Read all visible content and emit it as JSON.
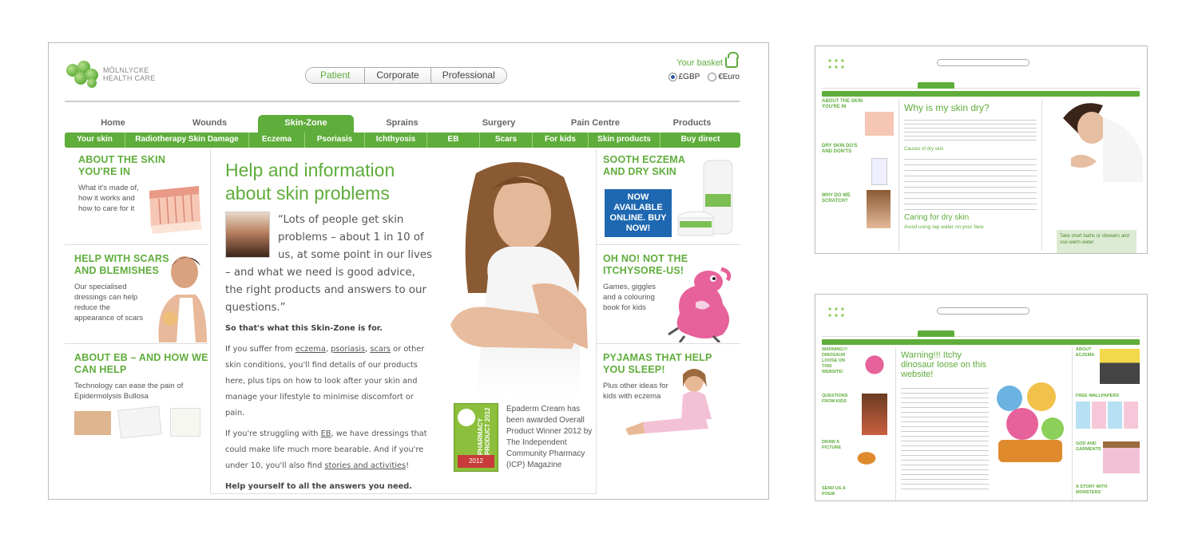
{
  "brand": {
    "name": "MÖLNLYCKE\nHEALTH CARE"
  },
  "audience_tabs": [
    "Patient",
    "Corporate",
    "Professional"
  ],
  "basket": {
    "label": "Your basket"
  },
  "currency": {
    "gbp": "£GBP",
    "euro": "€Euro"
  },
  "nav": [
    "Home",
    "Wounds",
    "Skin-Zone",
    "Sprains",
    "Surgery",
    "Pain Centre",
    "Products"
  ],
  "subnav": [
    "Your skin",
    "Radiotherapy Skin Damage",
    "Eczema",
    "Psoriasis",
    "Ichthyosis",
    "EB",
    "Scars",
    "For kids",
    "Skin products",
    "Buy direct"
  ],
  "left": [
    {
      "title": "ABOUT THE SKIN YOU'RE IN",
      "text": "What it's made of, how it works and how to care for it"
    },
    {
      "title": "HELP WITH SCARS AND BLEMISHES",
      "text": "Our specialised dressings can help reduce the appearance of scars"
    },
    {
      "title": "ABOUT EB – AND HOW WE CAN HELP",
      "text": "Technology can ease the pain of Epidermolysis Bullosa"
    }
  ],
  "right": [
    {
      "title": "SOOTH ECZEMA AND DRY SKIN",
      "button": "NOW AVAILABLE ONLINE. BUY NOW!"
    },
    {
      "title": "OH NO! NOT THE ITCHYSORE-US!",
      "text": "Games, giggles and a colouring book for kids"
    },
    {
      "title": "PYJAMAS THAT HELP YOU SLEEP!",
      "text": "Plus other ideas for kids with eczema"
    }
  ],
  "center": {
    "heading": "Help and information about skin problems",
    "quote": "“Lots of people get skin problems – about 1 in 10 of us, at some point in our lives – and what we need is good advice, the right products and answers to our questions.”",
    "lead": "So that's what this Skin-Zone is for.",
    "p1_a": "If you suffer from ",
    "p1_links": [
      "eczema",
      "psoriasis",
      "scars"
    ],
    "p1_b": " or other skin conditions, you'll find details of our products here, plus tips on how to look after your skin and manage your lifestyle to minimise discomfort or pain.",
    "p2_a": "If you're struggling with ",
    "p2_link": "EB",
    "p2_b": ", we have dressings that could make life much more bearable. And if you're under 10, you'll also find ",
    "p2_link2": "stories and activities",
    "p2_c": "!",
    "closing": "Help yourself to all the answers you need.",
    "award_text": "Epaderm Cream has been awarded Overall Product Winner 2012 by The Independent Community Pharmacy (ICP) Magazine",
    "award_badge": "PHARMACY PRODUCT 2012"
  },
  "thumb1": {
    "heading": "Why is my skin dry?",
    "sub1": "Causes of dry skin",
    "heading2": "Caring for dry skin",
    "sub2": "Avoid using tap water on your face",
    "side": [
      "ABOUT THE SKIN YOU'RE IN",
      "DRY SKIN DO'S AND DON'TS",
      "WHY DO WE SCRATCH?"
    ],
    "callout": "Take short baths or showers and use warm water"
  },
  "thumb2": {
    "heading": "Warning!!! Itchy dinosaur loose on this website!",
    "side": [
      "WARNING!!! DINOSAUR LOOSE ON THIS WEBSITE!",
      "QUESTIONS FROM KIDS",
      "DRAW A PICTURE",
      "SEND US A POEM"
    ],
    "right": [
      "ABOUT ECZEMA",
      "FREE WALLPAPERS",
      "GOD AND GARMENTS",
      "A STORY WITH MONSTERS"
    ]
  }
}
